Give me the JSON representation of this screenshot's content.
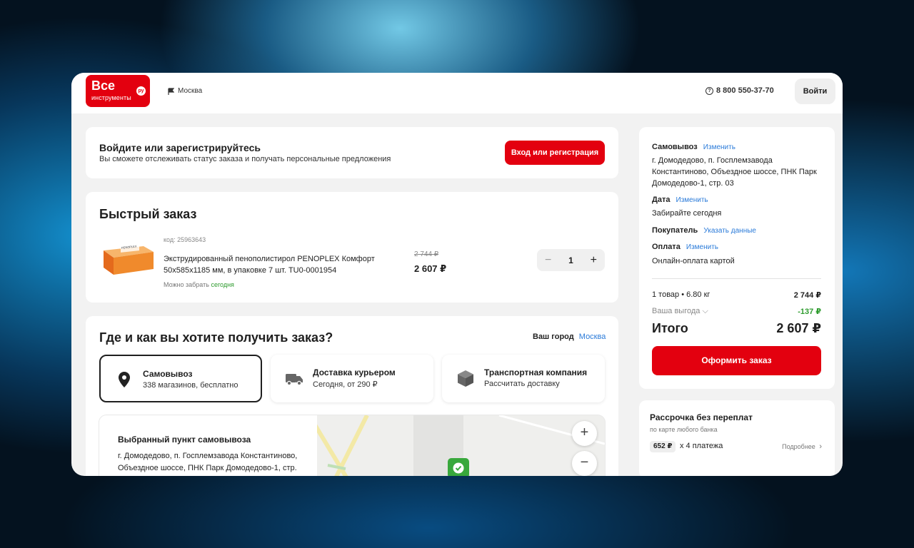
{
  "header": {
    "logo_line1": "Все",
    "logo_line2": "инструменты",
    "logo_badge": "ру",
    "city": "Москва",
    "phone": "8 800 550-37-70",
    "login_label": "Войти"
  },
  "login_card": {
    "title": "Войдите или зарегистрируйтесь",
    "subtitle": "Вы сможете отслеживать статус заказа и получать персональные предложения",
    "button_label": "Вход или регистрация"
  },
  "quick_order": {
    "title": "Быстрый заказ",
    "product": {
      "code": "код: 25963643",
      "name": "Экструдированный пенополистирол PENOPLEX Комфорт 50x585x1185 мм, в упаковке 7 шт. TU0-0001954",
      "pickup_prefix": "Можно забрать",
      "pickup_when": "сегодня",
      "old_price": "2 744 ₽",
      "price": "2 607 ₽",
      "quantity": "1",
      "box_text": "PENOPLEX"
    }
  },
  "delivery": {
    "title": "Где и как вы хотите получить заказ?",
    "your_city_label": "Ваш город",
    "your_city_value": "Москва",
    "options": [
      {
        "title": "Самовывоз",
        "subtitle": "338 магазинов, бесплатно",
        "icon": "location-pin-icon",
        "selected": true
      },
      {
        "title": "Доставка курьером",
        "subtitle": "Сегодня, от 290 ₽",
        "icon": "truck-icon",
        "selected": false
      },
      {
        "title": "Транспортная компания",
        "subtitle": "Рассчитать доставку",
        "icon": "package-icon",
        "selected": false
      }
    ],
    "map": {
      "title": "Выбранный пункт самовывоза",
      "address": "г. Домодедово, п. Госплемзавода Константиново, Объездное шоссе, ПНК Парк Домодедово-1, стр.",
      "zoom_in": "+",
      "zoom_out": "−"
    }
  },
  "summary": {
    "pickup_label": "Самовывоз",
    "pickup_link": "Изменить",
    "pickup_address": "г. Домодедово, п. Госплемзавода Константиново, Объездное шоссе, ПНК Парк Домодедово-1, стр. 03",
    "date_label": "Дата",
    "date_link": "Изменить",
    "date_value": "Забирайте сегодня",
    "buyer_label": "Покупатель",
    "buyer_link": "Указать данные",
    "payment_label": "Оплата",
    "payment_link": "Изменить",
    "payment_value": "Онлайн-оплата картой",
    "items_label": "1 товар • 6.80 кг",
    "items_price": "2 744 ₽",
    "benefit_label": "Ваша выгода",
    "benefit_value": "-137 ₽",
    "total_label": "Итого",
    "total_value": "2 607 ₽",
    "checkout_label": "Оформить заказ"
  },
  "installment": {
    "title": "Рассрочка без переплат",
    "subtitle": "по карте любого банка",
    "amount": "652 ₽",
    "payments": "x 4 платежа",
    "more_label": "Подробнее"
  },
  "colors": {
    "brand_red": "#e3000f",
    "link_blue": "#2b7bd9",
    "success_green": "#2e9b2e"
  }
}
